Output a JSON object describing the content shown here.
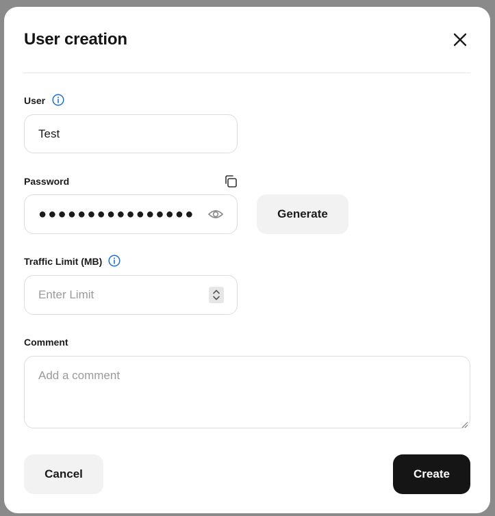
{
  "dialog": {
    "title": "User creation"
  },
  "user": {
    "label": "User",
    "value": "Test"
  },
  "password": {
    "label": "Password",
    "masked_value": "●●●●●●●●●●●●●●●●",
    "generate_label": "Generate"
  },
  "traffic": {
    "label": "Traffic Limit (MB)",
    "placeholder": "Enter Limit"
  },
  "comment": {
    "label": "Comment",
    "placeholder": "Add a comment"
  },
  "actions": {
    "cancel_label": "Cancel",
    "create_label": "Create"
  },
  "colors": {
    "accent": "#1a6fd4",
    "primary_button": "#151515",
    "secondary_button": "#f2f2f2"
  },
  "icons": [
    "close-icon",
    "info-icon",
    "copy-icon",
    "eye-icon",
    "stepper-icon",
    "resize-handle-icon"
  ]
}
